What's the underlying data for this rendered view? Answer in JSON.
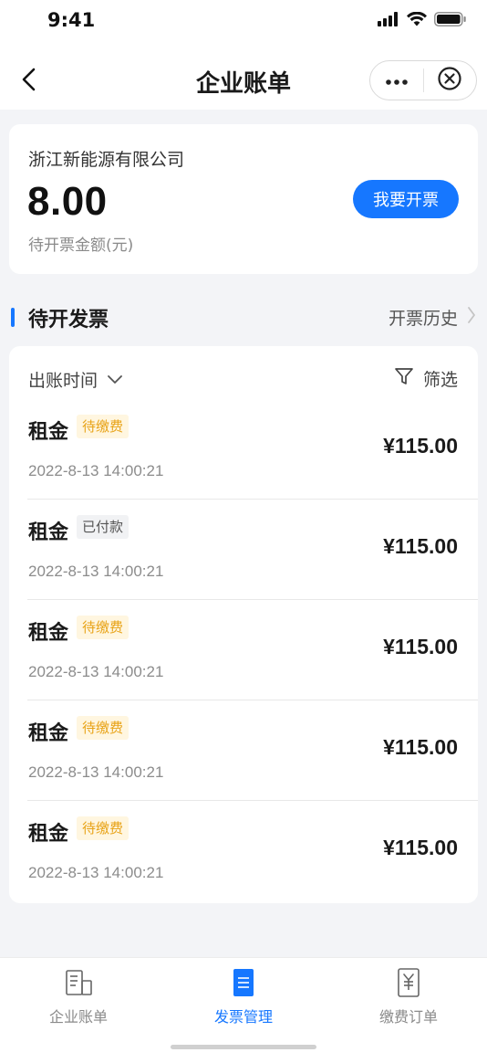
{
  "status_bar": {
    "time": "9:41"
  },
  "header": {
    "title": "企业账单",
    "back_icon": "chevron-left-icon",
    "more_icon": "more-dots-icon",
    "close_icon": "close-circle-icon"
  },
  "summary": {
    "company": "浙江新能源有限公司",
    "amount": "8.00",
    "amount_label": "待开票金额(元)",
    "invoice_button": "我要开票"
  },
  "section": {
    "title": "待开发票",
    "history_link": "开票历史"
  },
  "filters": {
    "sort_label": "出账时间",
    "filter_label": "筛选"
  },
  "bills": [
    {
      "name": "租金",
      "status": "待缴费",
      "status_type": "pending",
      "time": "2022-8-13 14:00:21",
      "amount": "¥115.00"
    },
    {
      "name": "租金",
      "status": "已付款",
      "status_type": "paid",
      "time": "2022-8-13 14:00:21",
      "amount": "¥115.00"
    },
    {
      "name": "租金",
      "status": "待缴费",
      "status_type": "pending",
      "time": "2022-8-13 14:00:21",
      "amount": "¥115.00"
    },
    {
      "name": "租金",
      "status": "待缴费",
      "status_type": "pending",
      "time": "2022-8-13 14:00:21",
      "amount": "¥115.00"
    },
    {
      "name": "租金",
      "status": "待缴费",
      "status_type": "pending",
      "time": "2022-8-13 14:00:21",
      "amount": "¥115.00"
    }
  ],
  "tabbar": {
    "tabs": [
      {
        "label": "企业账单",
        "icon": "bill-document-icon",
        "active": false
      },
      {
        "label": "发票管理",
        "icon": "invoice-icon",
        "active": true
      },
      {
        "label": "缴费订单",
        "icon": "yuan-receipt-icon",
        "active": false
      }
    ]
  },
  "colors": {
    "accent": "#1677ff",
    "pending_badge_bg": "#fff6e0",
    "pending_badge_text": "#e8a317",
    "paid_badge_bg": "#f1f2f4",
    "page_bg": "#f3f4f7"
  }
}
